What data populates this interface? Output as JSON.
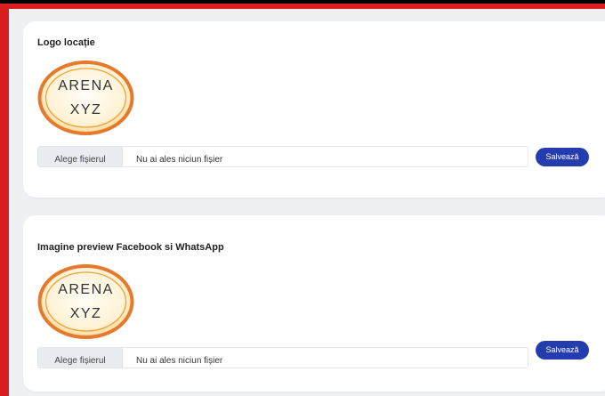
{
  "colors": {
    "frame": "#d81e1e",
    "page_background": "#eef0f4",
    "card_background": "#ffffff",
    "accent": "#243cad",
    "logo_border": "#e37a2d",
    "logo_fill": "#fff3d6"
  },
  "sections": [
    {
      "title": "Logo locație",
      "logo": {
        "line1": "ARENA",
        "line2": "XYZ"
      },
      "file_input": {
        "button_label": "Alege fișierul",
        "status_text": "Nu ai ales niciun fișier"
      },
      "save_label": "Salvează"
    },
    {
      "title": "Imagine preview Facebook si WhatsApp",
      "logo": {
        "line1": "ARENA",
        "line2": "XYZ"
      },
      "file_input": {
        "button_label": "Alege fișierul",
        "status_text": "Nu ai ales niciun fișier"
      },
      "save_label": "Salvează"
    }
  ]
}
